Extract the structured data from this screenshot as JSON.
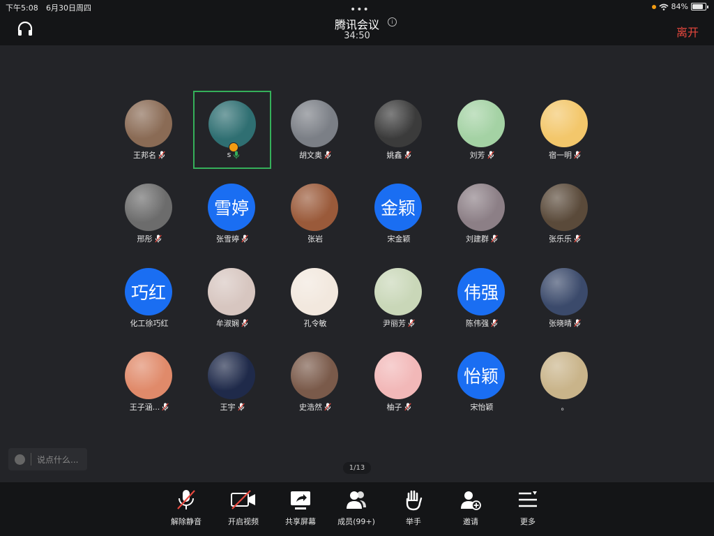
{
  "status": {
    "time": "下午5:08",
    "date": "6月30日周四",
    "battery": "84%"
  },
  "meeting": {
    "title": "腾讯会议",
    "duration": "34:50",
    "leave_label": "离开"
  },
  "participants": [
    {
      "name": "王邦名",
      "avatar": "photo",
      "color": "#8a6b55",
      "mic": "muted"
    },
    {
      "name": "s",
      "avatar": "photo",
      "color": "#2f6f72",
      "mic": "on",
      "host": true,
      "active": true
    },
    {
      "name": "胡文奥",
      "avatar": "photo",
      "color": "#7b7f86",
      "mic": "muted"
    },
    {
      "name": "姚鑫",
      "avatar": "photo",
      "color": "#3b3b3b",
      "mic": "muted"
    },
    {
      "name": "刘芳",
      "avatar": "photo",
      "color": "#a4d2a4",
      "mic": "muted"
    },
    {
      "name": "宿一明",
      "avatar": "photo",
      "color": "#f3c76b",
      "mic": "muted"
    },
    {
      "name": "邢彤",
      "avatar": "photo",
      "color": "#6c6c6c",
      "mic": "muted"
    },
    {
      "name": "张雪婷",
      "avatar": "text",
      "initials": "雪婷",
      "mic": "muted"
    },
    {
      "name": "张岩",
      "avatar": "photo",
      "color": "#9a5a3a",
      "mic": "none"
    },
    {
      "name": "宋金颖",
      "avatar": "text",
      "initials": "金颖",
      "mic": "none"
    },
    {
      "name": "刘建群",
      "avatar": "photo",
      "color": "#8c7f86",
      "mic": "muted"
    },
    {
      "name": "张乐乐",
      "avatar": "photo",
      "color": "#5a4a3a",
      "mic": "muted"
    },
    {
      "name": "化工徐巧红",
      "avatar": "text",
      "initials": "巧红",
      "mic": "none"
    },
    {
      "name": "牟淑娴",
      "avatar": "photo",
      "color": "#d7c6c0",
      "mic": "muted"
    },
    {
      "name": "孔令敏",
      "avatar": "photo",
      "color": "#f2e8de",
      "mic": "none"
    },
    {
      "name": "尹丽芳",
      "avatar": "photo",
      "color": "#c9d7b8",
      "mic": "muted"
    },
    {
      "name": "陈伟强",
      "avatar": "text",
      "initials": "伟强",
      "mic": "muted"
    },
    {
      "name": "张晓晴",
      "avatar": "photo",
      "color": "#3b4a6b",
      "mic": "muted"
    },
    {
      "name": "王子涵...",
      "avatar": "photo",
      "color": "#e08a6a",
      "mic": "muted"
    },
    {
      "name": "王宇",
      "avatar": "photo",
      "color": "#1f2a4a",
      "mic": "muted"
    },
    {
      "name": "史浩然",
      "avatar": "photo",
      "color": "#7a5a4a",
      "mic": "muted"
    },
    {
      "name": "柚子",
      "avatar": "photo",
      "color": "#f2b8b8",
      "mic": "muted"
    },
    {
      "name": "宋怡颖",
      "avatar": "text",
      "initials": "怡颖",
      "mic": "none"
    },
    {
      "name": "。",
      "avatar": "photo",
      "color": "#c9b48a",
      "mic": "none"
    }
  ],
  "chat": {
    "placeholder": "说点什么..."
  },
  "pagination": {
    "label": "1/13"
  },
  "toolbar": [
    {
      "id": "unmute",
      "label": "解除静音",
      "icon": "mic-off-icon"
    },
    {
      "id": "video",
      "label": "开启视频",
      "icon": "camera-off-icon"
    },
    {
      "id": "share",
      "label": "共享屏幕",
      "icon": "share-screen-icon"
    },
    {
      "id": "members",
      "label": "成员(99+)",
      "icon": "members-icon"
    },
    {
      "id": "raise",
      "label": "举手",
      "icon": "hand-icon"
    },
    {
      "id": "invite",
      "label": "邀请",
      "icon": "invite-icon"
    },
    {
      "id": "more",
      "label": "更多",
      "icon": "more-icon"
    }
  ],
  "colors": {
    "accent": "#1a6ef2",
    "leave": "#e8483e",
    "active_border": "#35b05a",
    "muted_mic": "#e8483e"
  }
}
